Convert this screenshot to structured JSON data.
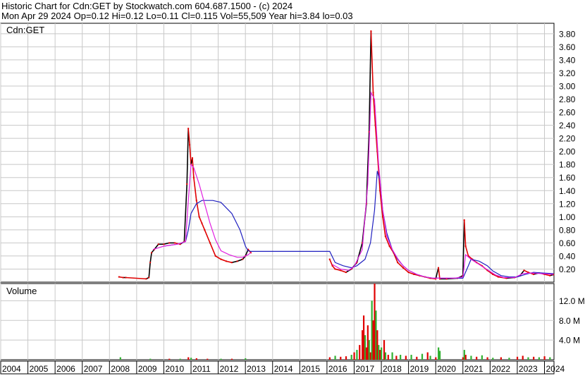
{
  "header": {
    "line1": "Historic Chart for Cdn:GET by Stockwatch.com 604.687.1500 - (c) 2024",
    "line2": "Mon Apr 29 2024  Op=0.12  Hi=0.12  Lo=0.11  Cl=0.115  Vol=55,509  Year hi=3.84  lo=0.03"
  },
  "colors": {
    "price_up": "#000000",
    "price_down": "#e00000",
    "ma_short": "#e020e0",
    "ma_long": "#2020c0",
    "vol_up": "#30b030",
    "vol_down": "#e00000",
    "grid": "#c8c8c8"
  },
  "chart_data": [
    {
      "type": "line",
      "panel": "price",
      "title": "Cdn:GET",
      "ylim": [
        0,
        3.96
      ],
      "y_ticks": [
        "0.20",
        "0.40",
        "0.60",
        "0.80",
        "1.00",
        "1.20",
        "1.40",
        "1.60",
        "1.80",
        "2.00",
        "2.20",
        "2.40",
        "2.60",
        "2.80",
        "3.00",
        "3.20",
        "3.40",
        "3.60",
        "3.80"
      ],
      "series": [
        {
          "role": "price",
          "points": [
            [
              2008.35,
              0.08
            ],
            [
              2008.5,
              0.07
            ],
            [
              2008.6,
              0.07
            ],
            [
              2009.35,
              0.05
            ],
            [
              2009.45,
              0.07
            ],
            [
              2009.5,
              0.3
            ],
            [
              2009.55,
              0.45
            ],
            [
              2009.65,
              0.5
            ],
            [
              2009.8,
              0.58
            ],
            [
              2010.0,
              0.58
            ],
            [
              2010.2,
              0.6
            ],
            [
              2010.4,
              0.6
            ],
            [
              2010.6,
              0.58
            ],
            [
              2010.75,
              0.62
            ],
            [
              2010.85,
              1.5
            ],
            [
              2010.9,
              2.35
            ],
            [
              2010.95,
              2.1
            ],
            [
              2011.0,
              1.8
            ],
            [
              2011.05,
              1.9
            ],
            [
              2011.1,
              1.6
            ],
            [
              2011.2,
              1.25
            ],
            [
              2011.3,
              1.0
            ],
            [
              2011.4,
              0.9
            ],
            [
              2011.5,
              0.8
            ],
            [
              2011.7,
              0.6
            ],
            [
              2011.9,
              0.4
            ],
            [
              2012.1,
              0.35
            ],
            [
              2012.3,
              0.32
            ],
            [
              2012.5,
              0.3
            ],
            [
              2012.7,
              0.32
            ],
            [
              2012.9,
              0.35
            ],
            [
              2013.0,
              0.4
            ],
            [
              2013.1,
              0.5
            ],
            [
              2013.2,
              0.45
            ],
            [
              2016.1,
              0.35
            ],
            [
              2016.2,
              0.25
            ],
            [
              2016.3,
              0.2
            ],
            [
              2016.5,
              0.18
            ],
            [
              2016.7,
              0.15
            ],
            [
              2016.9,
              0.2
            ],
            [
              2017.1,
              0.3
            ],
            [
              2017.3,
              0.6
            ],
            [
              2017.45,
              1.2
            ],
            [
              2017.55,
              2.3
            ],
            [
              2017.62,
              3.84
            ],
            [
              2017.7,
              2.9
            ],
            [
              2017.78,
              2.4
            ],
            [
              2017.85,
              2.0
            ],
            [
              2017.95,
              1.4
            ],
            [
              2018.05,
              1.0
            ],
            [
              2018.15,
              0.7
            ],
            [
              2018.3,
              0.55
            ],
            [
              2018.45,
              0.45
            ],
            [
              2018.6,
              0.3
            ],
            [
              2018.8,
              0.22
            ],
            [
              2019.0,
              0.15
            ],
            [
              2019.2,
              0.12
            ],
            [
              2019.4,
              0.1
            ],
            [
              2019.6,
              0.08
            ],
            [
              2019.8,
              0.06
            ],
            [
              2020.0,
              0.05
            ],
            [
              2020.1,
              0.22
            ],
            [
              2020.15,
              0.05
            ],
            [
              2020.4,
              0.05
            ],
            [
              2020.8,
              0.06
            ],
            [
              2021.0,
              0.1
            ],
            [
              2021.05,
              0.95
            ],
            [
              2021.1,
              0.55
            ],
            [
              2021.2,
              0.4
            ],
            [
              2021.35,
              0.35
            ],
            [
              2021.5,
              0.3
            ],
            [
              2021.7,
              0.25
            ],
            [
              2021.9,
              0.18
            ],
            [
              2022.1,
              0.12
            ],
            [
              2022.3,
              0.08
            ],
            [
              2022.6,
              0.06
            ],
            [
              2022.9,
              0.07
            ],
            [
              2023.1,
              0.1
            ],
            [
              2023.25,
              0.18
            ],
            [
              2023.4,
              0.15
            ],
            [
              2023.6,
              0.12
            ],
            [
              2023.8,
              0.14
            ],
            [
              2024.0,
              0.12
            ],
            [
              2024.2,
              0.1
            ],
            [
              2024.33,
              0.115
            ]
          ]
        },
        {
          "role": "moving-average-short",
          "points": [
            [
              2009.6,
              0.5
            ],
            [
              2010.0,
              0.55
            ],
            [
              2010.5,
              0.58
            ],
            [
              2010.8,
              0.62
            ],
            [
              2010.9,
              1.25
            ],
            [
              2011.0,
              1.8
            ],
            [
              2011.1,
              1.75
            ],
            [
              2011.3,
              1.5
            ],
            [
              2011.5,
              1.2
            ],
            [
              2011.7,
              0.9
            ],
            [
              2011.9,
              0.65
            ],
            [
              2012.1,
              0.48
            ],
            [
              2012.4,
              0.42
            ],
            [
              2012.7,
              0.38
            ],
            [
              2012.9,
              0.38
            ],
            [
              2013.0,
              0.4
            ],
            [
              2013.1,
              0.42
            ],
            [
              2013.2,
              0.45
            ],
            [
              2016.2,
              0.27
            ],
            [
              2016.5,
              0.2
            ],
            [
              2016.8,
              0.18
            ],
            [
              2017.0,
              0.24
            ],
            [
              2017.3,
              0.5
            ],
            [
              2017.5,
              1.5
            ],
            [
              2017.62,
              2.9
            ],
            [
              2017.75,
              2.8
            ],
            [
              2017.9,
              1.8
            ],
            [
              2018.05,
              1.1
            ],
            [
              2018.2,
              0.7
            ],
            [
              2018.4,
              0.5
            ],
            [
              2018.6,
              0.36
            ],
            [
              2018.8,
              0.25
            ],
            [
              2019.0,
              0.18
            ],
            [
              2019.3,
              0.12
            ],
            [
              2019.6,
              0.08
            ],
            [
              2019.9,
              0.06
            ],
            [
              2020.3,
              0.06
            ],
            [
              2020.7,
              0.06
            ],
            [
              2021.0,
              0.08
            ],
            [
              2021.1,
              0.42
            ],
            [
              2021.3,
              0.35
            ],
            [
              2021.6,
              0.27
            ],
            [
              2021.9,
              0.19
            ],
            [
              2022.2,
              0.11
            ],
            [
              2022.5,
              0.07
            ],
            [
              2022.9,
              0.07
            ],
            [
              2023.2,
              0.13
            ],
            [
              2023.5,
              0.14
            ],
            [
              2023.9,
              0.13
            ],
            [
              2024.33,
              0.12
            ]
          ]
        },
        {
          "role": "moving-average-long",
          "points": [
            [
              2010.0,
              0.55
            ],
            [
              2010.5,
              0.58
            ],
            [
              2010.8,
              0.62
            ],
            [
              2010.9,
              0.8
            ],
            [
              2011.0,
              1.05
            ],
            [
              2011.2,
              1.2
            ],
            [
              2011.4,
              1.25
            ],
            [
              2011.8,
              1.25
            ],
            [
              2012.1,
              1.22
            ],
            [
              2012.5,
              1.05
            ],
            [
              2012.8,
              0.8
            ],
            [
              2013.0,
              0.55
            ],
            [
              2013.1,
              0.48
            ],
            [
              2013.2,
              0.47
            ],
            [
              2014.0,
              0.47
            ],
            [
              2015.0,
              0.47
            ],
            [
              2016.1,
              0.47
            ],
            [
              2016.3,
              0.3
            ],
            [
              2016.6,
              0.25
            ],
            [
              2016.9,
              0.22
            ],
            [
              2017.1,
              0.25
            ],
            [
              2017.4,
              0.35
            ],
            [
              2017.6,
              0.6
            ],
            [
              2017.75,
              1.1
            ],
            [
              2017.85,
              1.7
            ],
            [
              2017.95,
              1.55
            ],
            [
              2018.05,
              1.1
            ],
            [
              2018.2,
              0.75
            ],
            [
              2018.4,
              0.5
            ],
            [
              2018.6,
              0.35
            ],
            [
              2018.8,
              0.25
            ],
            [
              2019.0,
              0.18
            ],
            [
              2019.3,
              0.12
            ],
            [
              2019.6,
              0.08
            ],
            [
              2019.9,
              0.06
            ],
            [
              2020.5,
              0.06
            ],
            [
              2021.0,
              0.06
            ],
            [
              2021.2,
              0.25
            ],
            [
              2021.3,
              0.35
            ],
            [
              2021.6,
              0.32
            ],
            [
              2021.9,
              0.25
            ],
            [
              2022.1,
              0.17
            ],
            [
              2022.4,
              0.1
            ],
            [
              2022.7,
              0.08
            ],
            [
              2023.0,
              0.08
            ],
            [
              2023.3,
              0.12
            ],
            [
              2023.6,
              0.15
            ],
            [
              2023.9,
              0.14
            ],
            [
              2024.33,
              0.13
            ]
          ]
        }
      ]
    },
    {
      "type": "bar",
      "panel": "volume",
      "title": "Volume",
      "ylim": [
        0,
        15.5
      ],
      "y_ticks": [
        "4.0 M",
        "8.0 M",
        "12.0 M"
      ],
      "x_ticks": [
        "2004",
        "2005",
        "2006",
        "2007",
        "2008",
        "2009",
        "2010",
        "2011",
        "2012",
        "2013",
        "2014",
        "2015",
        "2016",
        "2017",
        "2018",
        "2019",
        "2020",
        "2021",
        "2022",
        "2023",
        "2024"
      ],
      "bars": [
        [
          2008.4,
          0.5,
          "up"
        ],
        [
          2009.5,
          0.2,
          "up"
        ],
        [
          2010.2,
          0.2,
          "down"
        ],
        [
          2010.6,
          0.2,
          "up"
        ],
        [
          2010.9,
          0.5,
          "down"
        ],
        [
          2011.0,
          0.4,
          "up"
        ],
        [
          2011.2,
          0.3,
          "down"
        ],
        [
          2011.6,
          0.2,
          "down"
        ],
        [
          2012.1,
          0.2,
          "up"
        ],
        [
          2012.5,
          0.2,
          "down"
        ],
        [
          2013.0,
          0.3,
          "up"
        ],
        [
          2016.1,
          0.5,
          "down"
        ],
        [
          2016.3,
          0.8,
          "up"
        ],
        [
          2016.5,
          0.6,
          "down"
        ],
        [
          2016.7,
          0.7,
          "down"
        ],
        [
          2016.9,
          1.0,
          "up"
        ],
        [
          2017.0,
          1.5,
          "down"
        ],
        [
          2017.1,
          2.0,
          "up"
        ],
        [
          2017.2,
          3.0,
          "down"
        ],
        [
          2017.3,
          6.0,
          "down"
        ],
        [
          2017.35,
          9.0,
          "down"
        ],
        [
          2017.4,
          5.0,
          "up"
        ],
        [
          2017.45,
          2.5,
          "down"
        ],
        [
          2017.5,
          7.0,
          "down"
        ],
        [
          2017.55,
          4.0,
          "up"
        ],
        [
          2017.6,
          1.5,
          "down"
        ],
        [
          2017.65,
          12.0,
          "up"
        ],
        [
          2017.7,
          8.0,
          "down"
        ],
        [
          2017.75,
          15.5,
          "down"
        ],
        [
          2017.8,
          10.0,
          "up"
        ],
        [
          2017.85,
          6.0,
          "down"
        ],
        [
          2017.9,
          3.0,
          "up"
        ],
        [
          2017.95,
          2.0,
          "down"
        ],
        [
          2018.0,
          2.5,
          "up"
        ],
        [
          2018.1,
          4.0,
          "down"
        ],
        [
          2018.15,
          1.5,
          "up"
        ],
        [
          2018.25,
          1.0,
          "down"
        ],
        [
          2018.4,
          1.5,
          "up"
        ],
        [
          2018.55,
          0.8,
          "down"
        ],
        [
          2018.7,
          1.0,
          "up"
        ],
        [
          2018.9,
          0.8,
          "down"
        ],
        [
          2019.1,
          1.0,
          "up"
        ],
        [
          2019.3,
          0.6,
          "down"
        ],
        [
          2019.5,
          1.2,
          "up"
        ],
        [
          2019.7,
          1.5,
          "down"
        ],
        [
          2019.8,
          0.8,
          "up"
        ],
        [
          2020.0,
          0.5,
          "down"
        ],
        [
          2020.1,
          2.5,
          "up"
        ],
        [
          2020.15,
          1.8,
          "up"
        ],
        [
          2021.0,
          0.5,
          "down"
        ],
        [
          2021.05,
          2.0,
          "up"
        ],
        [
          2021.1,
          1.0,
          "down"
        ],
        [
          2021.3,
          0.8,
          "up"
        ],
        [
          2021.5,
          0.6,
          "down"
        ],
        [
          2021.7,
          0.9,
          "up"
        ],
        [
          2021.9,
          0.5,
          "down"
        ],
        [
          2022.1,
          0.4,
          "up"
        ],
        [
          2022.4,
          0.5,
          "down"
        ],
        [
          2022.7,
          0.4,
          "up"
        ],
        [
          2023.0,
          0.6,
          "down"
        ],
        [
          2023.2,
          0.8,
          "down"
        ],
        [
          2023.4,
          0.5,
          "up"
        ],
        [
          2023.6,
          0.6,
          "down"
        ],
        [
          2023.8,
          0.5,
          "up"
        ],
        [
          2024.0,
          0.7,
          "down"
        ],
        [
          2024.2,
          0.5,
          "up"
        ]
      ]
    }
  ]
}
